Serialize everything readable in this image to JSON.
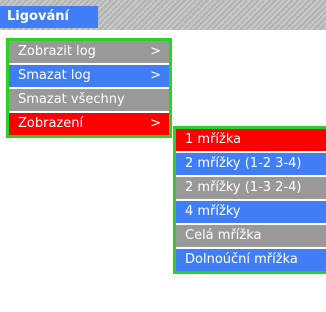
{
  "menubar": {
    "title": "Ligování"
  },
  "menu": {
    "items": [
      {
        "label": "Zobrazit log",
        "chevron": ">"
      },
      {
        "label": "Smazat log",
        "chevron": ">"
      },
      {
        "label": "Smazat všechny"
      },
      {
        "label": "Zobrazení",
        "chevron": ">"
      }
    ]
  },
  "submenu": {
    "items": [
      {
        "label": "1 mřížka"
      },
      {
        "label": "2 mřížky (1-2 3-4)"
      },
      {
        "label": "2 mřížky (1-3 2-4)"
      },
      {
        "label": "4 mřížky"
      },
      {
        "label": "Celá mřížka"
      },
      {
        "label": "Dolnoúční mřížka"
      }
    ]
  },
  "colors": {
    "blue": "#3f7ef6",
    "gray": "#999999",
    "red": "#ff0000",
    "green_border": "#27d31f"
  }
}
